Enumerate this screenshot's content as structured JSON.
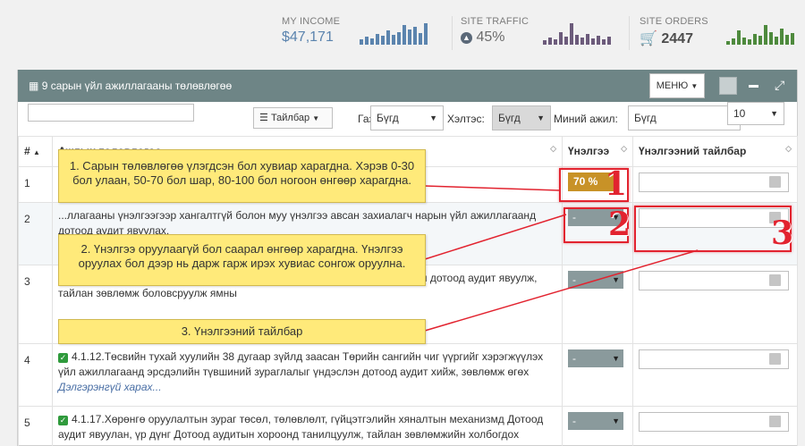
{
  "stats": {
    "income": {
      "label": "MY INCOME",
      "value": "$47,171",
      "color": "#5b84ae"
    },
    "traffic": {
      "label": "SITE TRAFFIC",
      "value": "45%",
      "icon": "arrow-up-circle-icon",
      "color": "#6c5b7b"
    },
    "orders": {
      "label": "SITE ORDERS",
      "value": "2447",
      "icon": "cart-icon",
      "color": "#4e8a3d"
    }
  },
  "widget": {
    "title": "9 сарын үйл ажиллагааны төлөвлөгөө",
    "menu_label": "МЕНЮ"
  },
  "filters": {
    "search_value": "",
    "tailbar_label": "Тайлбар",
    "gazar_label": "Газар:",
    "gazar_value": "Бүгд",
    "kheltes_label": "Хэлтэс:",
    "kheltes_value": "Бүгд",
    "minii_label": "Миний ажил:",
    "minii_value": "Бүгд",
    "page_size": "10"
  },
  "table": {
    "headers": {
      "num": "#",
      "task": "Ажлын төлөвлөгөө",
      "score": "Үнэлгээ",
      "comment": "Үнэлгээний тайлбар"
    },
    "rows": [
      {
        "num": "1",
        "text": "",
        "score": "70 %"
      },
      {
        "num": "2",
        "text": "...ллагааны үнэлгээгээр хангалтгүй болон муу үнэлгээ авсан захиалагч нарын үйл ажиллагаанд дотоод аудит явуулах,",
        "score": "-"
      },
      {
        "num": "3",
        "text": "...жилт нь хангалтгүй ...газруудтай хамтарсан болон дангаар гүйцэтгэлийн дотоод аудит явуулж, тайлан зөвлөмж боловсруулж ямны",
        "score": "-"
      },
      {
        "num": "4",
        "text": "4.1.12.Төсвийн тухай хуулийн 38 дугаар зүйлд заасан Төрийн сангийн чиг үүргийг хэрэгжүүлэх үйл ажиллагаанд эрсдэлийн түвшиний зураглалыг үндэслэн дотоод аудит хийж, зөвлөмж өгөх",
        "more": "Дэлгэрэнгүй харах...",
        "score": "-"
      },
      {
        "num": "5",
        "text": "4.1.17.Хөрөнгө оруулалтын зураг төсөл, төлөвлөлт, гүйцэтгэлийн хяналтын механизмд Дотоод аудит явуулан, үр дүнг Дотоод аудитын хороонд танилцуулж, тайлан зөвлөмжийн холбогдох",
        "score": "-"
      }
    ]
  },
  "annotations": {
    "note1": "1. Сарын төлөвлөгөө үлэгдсэн бол хувиар харагдна. Хэрэв 0-30 бол улаан, 50-70 бол шар, 80-100 бол ногоон өнгөөр харагдна.",
    "note2": "2. Үнэлгээ оруулаагүй бол саарал өнгөөр харагдна. Үнэлгээ оруулах бол дээр нь дарж гарж ирэх хувиас сонгож оруулна.",
    "note3": "3. Үнэлгээний тайлбар",
    "n1": "1",
    "n2": "2",
    "n3": "3"
  }
}
